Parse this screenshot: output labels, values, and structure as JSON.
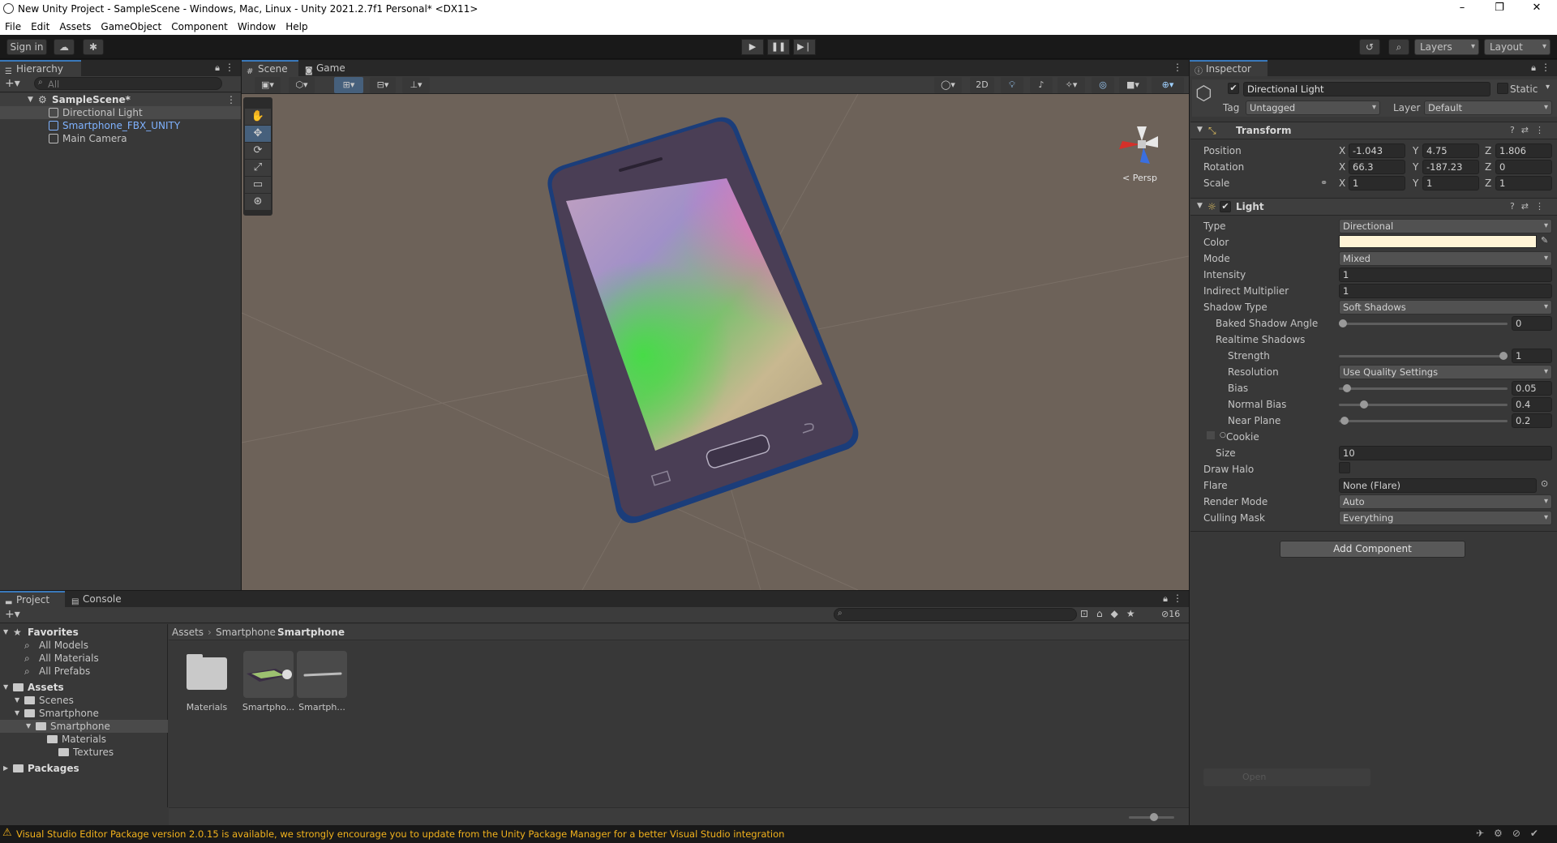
{
  "window": {
    "title": "New Unity Project - SampleScene - Windows, Mac, Linux - Unity 2021.2.7f1 Personal* <DX11>",
    "controls": [
      "–",
      "❐",
      "✕"
    ]
  },
  "menu": [
    "File",
    "Edit",
    "Assets",
    "GameObject",
    "Component",
    "Window",
    "Help"
  ],
  "toolbar": {
    "sign_in": "Sign in",
    "layers": "Layers",
    "layout": "Layout"
  },
  "hierarchy": {
    "tab": "Hierarchy",
    "search_placeholder": "All",
    "scene": "SampleScene*",
    "items": [
      {
        "label": "Directional Light",
        "selected": true,
        "color": "#c4c4c4"
      },
      {
        "label": "Smartphone_FBX_UNITY",
        "selected": false,
        "color": "#7fb2ff"
      },
      {
        "label": "Main Camera",
        "selected": false,
        "color": "#c4c4c4"
      }
    ]
  },
  "scene_view": {
    "tabs": [
      "Scene",
      "Game"
    ],
    "btn_2d": "2D",
    "persp": "< Persp",
    "background": "#6d6259"
  },
  "inspector": {
    "tab": "Inspector",
    "object_name": "Directional Light",
    "static_label": "Static",
    "tag_label": "Tag",
    "tag_value": "Untagged",
    "layer_label": "Layer",
    "layer_value": "Default",
    "transform": {
      "title": "Transform",
      "position_label": "Position",
      "rotation_label": "Rotation",
      "scale_label": "Scale",
      "position": {
        "x": "-1.043",
        "y": "4.75",
        "z": "1.806"
      },
      "rotation": {
        "x": "66.3",
        "y": "-187.23",
        "z": "0"
      },
      "scale": {
        "x": "1",
        "y": "1",
        "z": "1"
      }
    },
    "light": {
      "title": "Light",
      "rows": {
        "type": {
          "label": "Type",
          "value": "Directional"
        },
        "color": {
          "label": "Color",
          "value": "#fff4d6"
        },
        "mode": {
          "label": "Mode",
          "value": "Mixed"
        },
        "intensity": {
          "label": "Intensity",
          "value": "1"
        },
        "indirect": {
          "label": "Indirect Multiplier",
          "value": "1"
        },
        "shadow_type": {
          "label": "Shadow Type",
          "value": "Soft Shadows"
        },
        "baked_angle": {
          "label": "Baked Shadow Angle",
          "value": "0",
          "level": 0
        },
        "realtime": {
          "label": "Realtime Shadows"
        },
        "strength": {
          "label": "Strength",
          "value": "1",
          "level": 1
        },
        "resolution": {
          "label": "Resolution",
          "value": "Use Quality Settings"
        },
        "bias": {
          "label": "Bias",
          "value": "0.05",
          "level": 0.025
        },
        "normal_bias": {
          "label": "Normal Bias",
          "value": "0.4",
          "level": 0.133
        },
        "near_plane": {
          "label": "Near Plane",
          "value": "0.2",
          "level": 0.01
        },
        "cookie": {
          "label": "Cookie"
        },
        "size": {
          "label": "Size",
          "value": "10"
        },
        "draw_halo": {
          "label": "Draw Halo"
        },
        "flare": {
          "label": "Flare",
          "value": "None (Flare)"
        },
        "render_mode": {
          "label": "Render Mode",
          "value": "Auto"
        },
        "culling_mask": {
          "label": "Culling Mask",
          "value": "Everything"
        }
      }
    },
    "add_component": "Add Component",
    "open_label": "Open"
  },
  "project": {
    "tabs": [
      "Project",
      "Console"
    ],
    "hidden_count": "16",
    "breadcrumb": [
      "Assets",
      "Smartphone",
      "Smartphone"
    ],
    "tree": [
      {
        "label": "Favorites",
        "level": 0,
        "bold": true,
        "kind": "star"
      },
      {
        "label": "All Models",
        "level": 1,
        "kind": "search"
      },
      {
        "label": "All Materials",
        "level": 1,
        "kind": "search"
      },
      {
        "label": "All Prefabs",
        "level": 1,
        "kind": "search"
      },
      {
        "label": "Assets",
        "level": 0,
        "bold": true,
        "kind": "folder"
      },
      {
        "label": "Scenes",
        "level": 1,
        "kind": "folder"
      },
      {
        "label": "Smartphone",
        "level": 1,
        "kind": "folder"
      },
      {
        "label": "Smartphone",
        "level": 2,
        "kind": "folder",
        "selected": true
      },
      {
        "label": "Materials",
        "level": 3,
        "kind": "folder"
      },
      {
        "label": "Textures",
        "level": 4,
        "kind": "folder"
      },
      {
        "label": "Packages",
        "level": 0,
        "bold": true,
        "kind": "folder"
      }
    ],
    "assets": [
      "Materials",
      "Smartpho...",
      "Smartph..."
    ]
  },
  "statusbar": {
    "message": "Visual Studio Editor Package version 2.0.15 is available, we strongly encourage you to update from the Unity Package Manager for a better Visual Studio integration",
    "warn_color": "#f2b21c"
  }
}
